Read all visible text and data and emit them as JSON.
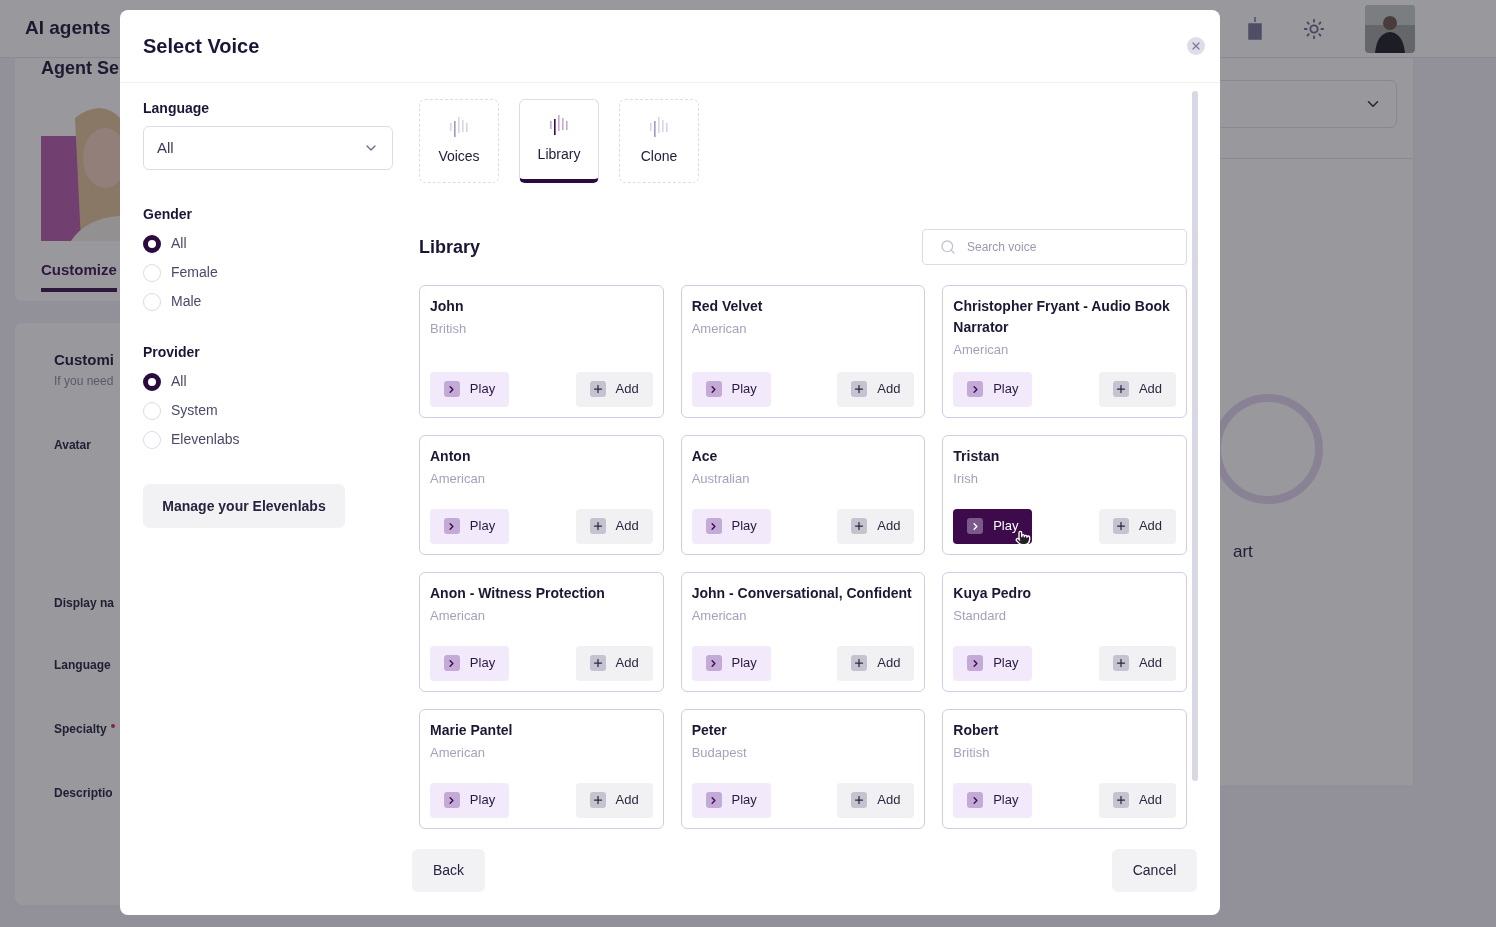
{
  "app_header": {
    "title": "AI agents"
  },
  "background": {
    "page_title": "Agent Se",
    "tab": "Customize",
    "section_title": "Customi",
    "section_hint": "If you need",
    "fields": [
      {
        "label": "Avatar"
      },
      {
        "label": "Display na"
      },
      {
        "label": "Language"
      },
      {
        "label": "Specialty",
        "required": true
      },
      {
        "label": "Descriptio"
      }
    ],
    "right_text": "art"
  },
  "dialog": {
    "title": "Select Voice",
    "language": {
      "label": "Language",
      "value": "All"
    },
    "gender": {
      "label": "Gender",
      "options": [
        {
          "label": "All",
          "selected": true
        },
        {
          "label": "Female",
          "selected": false
        },
        {
          "label": "Male",
          "selected": false
        }
      ]
    },
    "provider": {
      "label": "Provider",
      "options": [
        {
          "label": "All",
          "selected": true
        },
        {
          "label": "System",
          "selected": false
        },
        {
          "label": "Elevenlabs",
          "selected": false
        }
      ]
    },
    "manage_button": "Manage your Elevenlabs",
    "tabs": [
      {
        "label": "Voices",
        "selected": false
      },
      {
        "label": "Library",
        "selected": true
      },
      {
        "label": "Clone",
        "selected": false
      }
    ],
    "section_title": "Library",
    "search": {
      "placeholder": "Search voice"
    },
    "voices": [
      {
        "name": "John",
        "accent": "British",
        "play": "Play",
        "add": "Add",
        "highlighted": false
      },
      {
        "name": "Red Velvet",
        "accent": "American",
        "play": "Play",
        "add": "Add",
        "highlighted": false
      },
      {
        "name": "Christopher Fryant - Audio Book Narrator",
        "accent": "American",
        "play": "Play",
        "add": "Add",
        "highlighted": false
      },
      {
        "name": "Anton",
        "accent": "American",
        "play": "Play",
        "add": "Add",
        "highlighted": false
      },
      {
        "name": "Ace",
        "accent": "Australian",
        "play": "Play",
        "add": "Add",
        "highlighted": false
      },
      {
        "name": "Tristan",
        "accent": "Irish",
        "play": "Play",
        "add": "Add",
        "highlighted": true
      },
      {
        "name": "Anon - Witness Protection",
        "accent": "American",
        "play": "Play",
        "add": "Add",
        "highlighted": false
      },
      {
        "name": "John - Conversational, Confident",
        "accent": "American",
        "play": "Play",
        "add": "Add",
        "highlighted": false
      },
      {
        "name": "Kuya Pedro",
        "accent": "Standard",
        "play": "Play",
        "add": "Add",
        "highlighted": false
      },
      {
        "name": "Marie Pantel",
        "accent": "American",
        "play": "Play",
        "add": "Add",
        "highlighted": false
      },
      {
        "name": "Peter",
        "accent": "Budapest",
        "play": "Play",
        "add": "Add",
        "highlighted": false
      },
      {
        "name": "Robert",
        "accent": "British",
        "play": "Play",
        "add": "Add",
        "highlighted": false
      }
    ],
    "back_button": "Back",
    "cancel_button": "Cancel"
  }
}
